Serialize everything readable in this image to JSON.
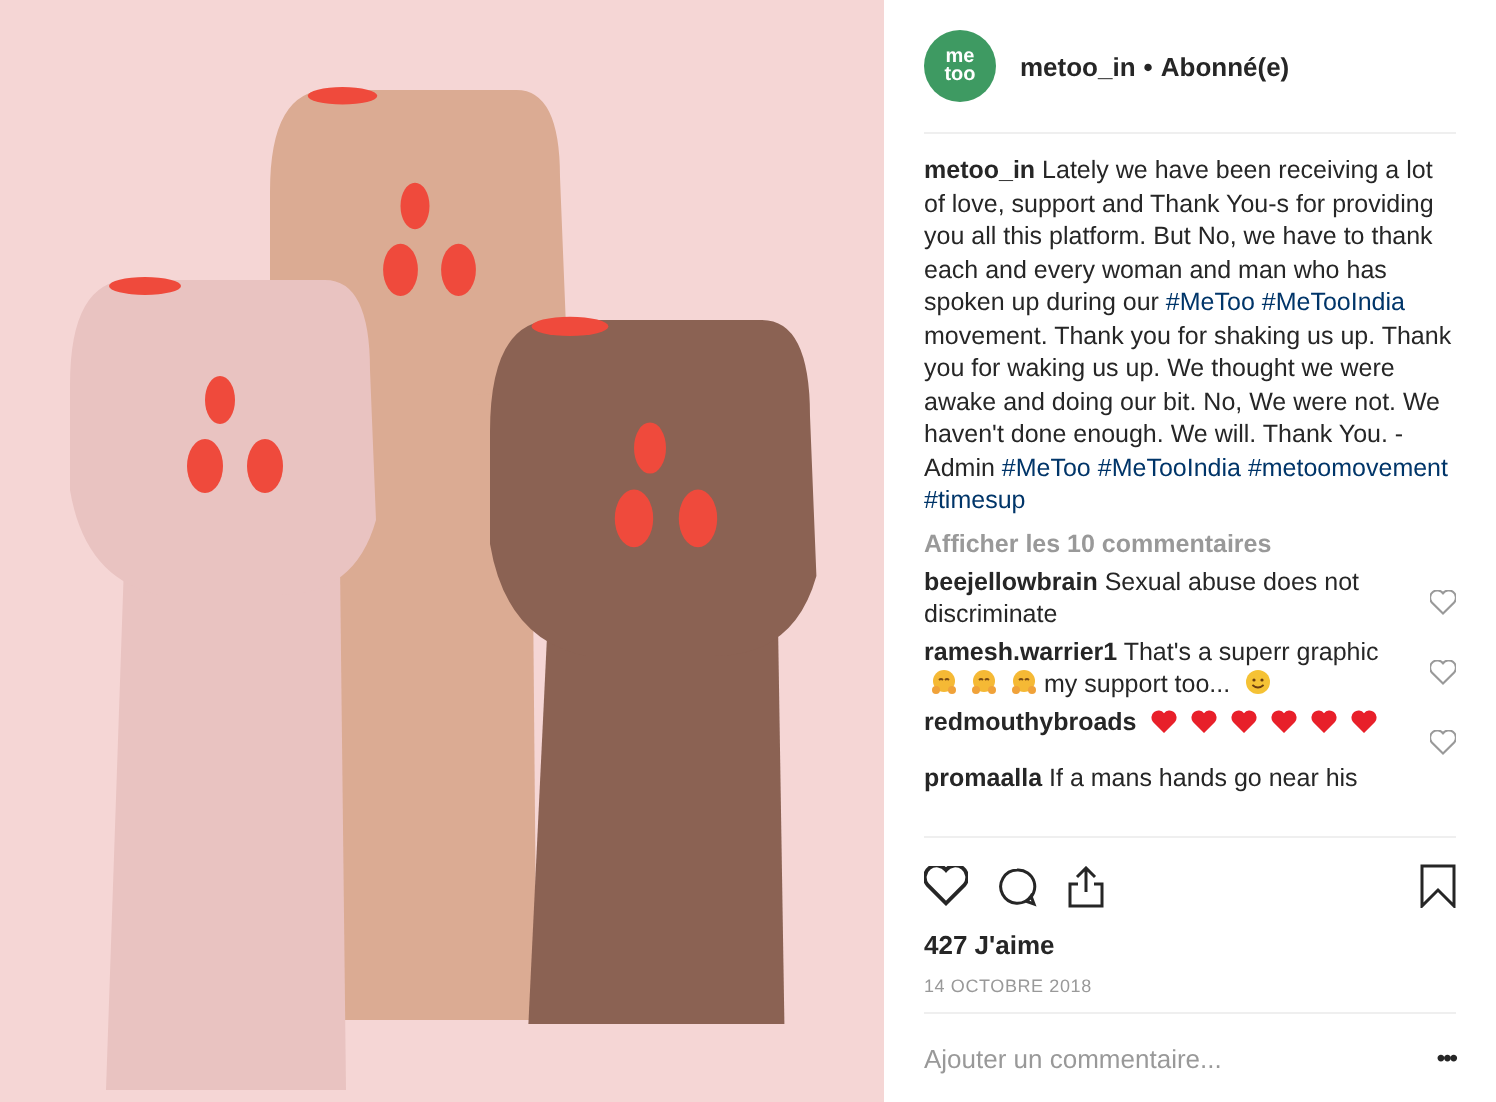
{
  "post_image": {
    "kind": "fists"
  },
  "header": {
    "avatar": {
      "lines": [
        "me",
        "too"
      ]
    },
    "username": "metoo_in",
    "separator": "•",
    "status": "Abonné(e)"
  },
  "caption": {
    "username": "metoo_in",
    "segments": [
      {
        "kind": "text",
        "text": "Lately we have been receiving a lot of love, support and Thank You-s for providing you all this platform. But No, we have to thank each and every woman and man who has spoken up during our "
      },
      {
        "kind": "hashtag",
        "text": "#MeToo"
      },
      {
        "kind": "hashtag",
        "text": "#MeTooIndia"
      },
      {
        "kind": "text",
        "text": " movement. Thank you for shaking us up. Thank you for waking us up. We thought we were awake and doing our bit. No, We were not. We haven't done enough. We will. Thank You. - Admin "
      },
      {
        "kind": "hashtag",
        "text": "#MeToo"
      },
      {
        "kind": "hashtag",
        "text": "#MeTooIndia"
      },
      {
        "kind": "hashtag",
        "text": "#metoomovement"
      },
      {
        "kind": "hashtag",
        "text": "#timesup"
      }
    ]
  },
  "view_comments": "Afficher les 10 commentaires",
  "comments": [
    {
      "username": "beejellowbrain",
      "parts": [
        {
          "kind": "text",
          "text": "Sexual abuse does not discriminate"
        }
      ],
      "liked": false
    },
    {
      "username": "ramesh.warrier1",
      "parts": [
        {
          "kind": "text",
          "text": "That's a superr graphic"
        },
        {
          "kind": "hug_emoji"
        },
        {
          "kind": "hug_emoji"
        },
        {
          "kind": "hug_emoji"
        },
        {
          "kind": "text",
          "text": "my support too..."
        },
        {
          "kind": "smile_emoji"
        }
      ],
      "liked": false
    },
    {
      "username": "redmouthybroads",
      "parts": [
        {
          "kind": "heart_emoji"
        },
        {
          "kind": "heart_emoji"
        },
        {
          "kind": "heart_emoji"
        },
        {
          "kind": "heart_emoji"
        },
        {
          "kind": "heart_emoji"
        },
        {
          "kind": "heart_emoji"
        }
      ],
      "liked": false
    },
    {
      "username": "promaalla",
      "parts": [
        {
          "kind": "text",
          "text": "If a mans hands go near his"
        }
      ]
    }
  ],
  "actions": {
    "liked": false,
    "saved": false
  },
  "likes": "427 J'aime",
  "date": "14 OCTOBRE 2018",
  "add_comment": {
    "placeholder": "Ajouter un commentaire...",
    "more": "•••"
  }
}
